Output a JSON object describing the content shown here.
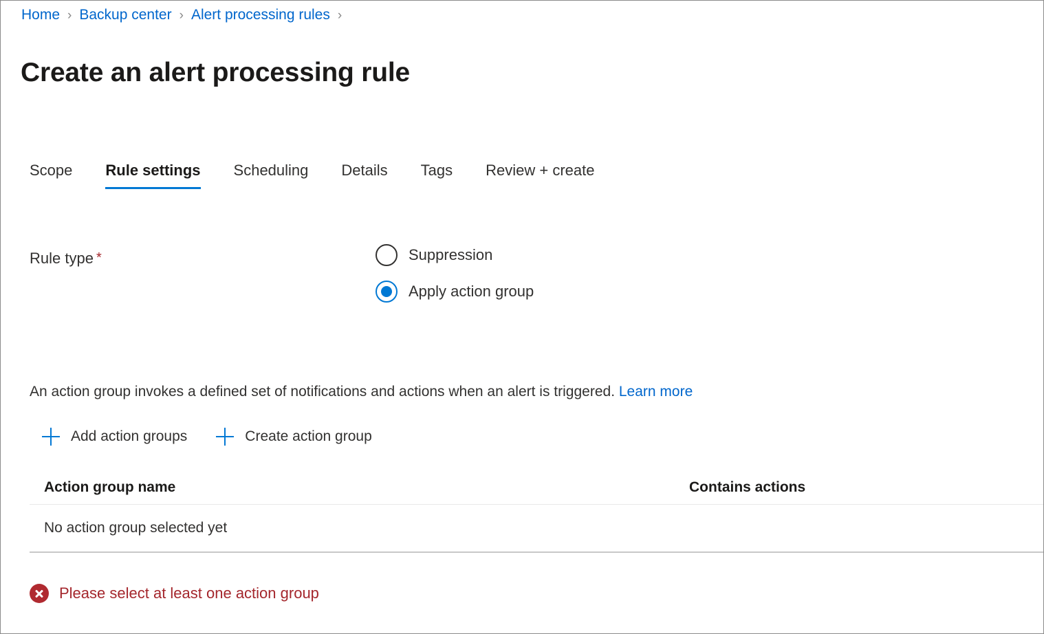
{
  "breadcrumb": {
    "separator": "›",
    "items": [
      {
        "label": "Home"
      },
      {
        "label": "Backup center"
      },
      {
        "label": "Alert processing rules"
      }
    ]
  },
  "page": {
    "title": "Create an alert processing rule"
  },
  "tabs": [
    {
      "label": "Scope",
      "active": false
    },
    {
      "label": "Rule settings",
      "active": true
    },
    {
      "label": "Scheduling",
      "active": false
    },
    {
      "label": "Details",
      "active": false
    },
    {
      "label": "Tags",
      "active": false
    },
    {
      "label": "Review + create",
      "active": false
    }
  ],
  "rule_type": {
    "label": "Rule type",
    "required_marker": "*",
    "options": [
      {
        "label": "Suppression",
        "selected": false
      },
      {
        "label": "Apply action group",
        "selected": true
      }
    ]
  },
  "description": {
    "text": "An action group invokes a defined set of notifications and actions when an alert is triggered.",
    "link_label": "Learn more"
  },
  "command_bar": {
    "buttons": [
      {
        "label": "Add action groups",
        "icon": "plus-icon"
      },
      {
        "label": "Create action group",
        "icon": "plus-icon"
      }
    ]
  },
  "action_group_table": {
    "columns": [
      "Action group name",
      "Contains actions"
    ],
    "rows": [
      {
        "name": "No action group selected yet",
        "contains_actions": ""
      }
    ]
  },
  "validation": {
    "icon": "error-circle-x-icon",
    "message": "Please select at least one action group"
  },
  "colors": {
    "link": "#0066cc",
    "accent": "#0078d4",
    "error": "#a4262c",
    "error_icon_fill": "#b02a30",
    "text": "#323130",
    "divider_light": "#e8e8e8",
    "divider_dark": "#c8c8c8"
  }
}
